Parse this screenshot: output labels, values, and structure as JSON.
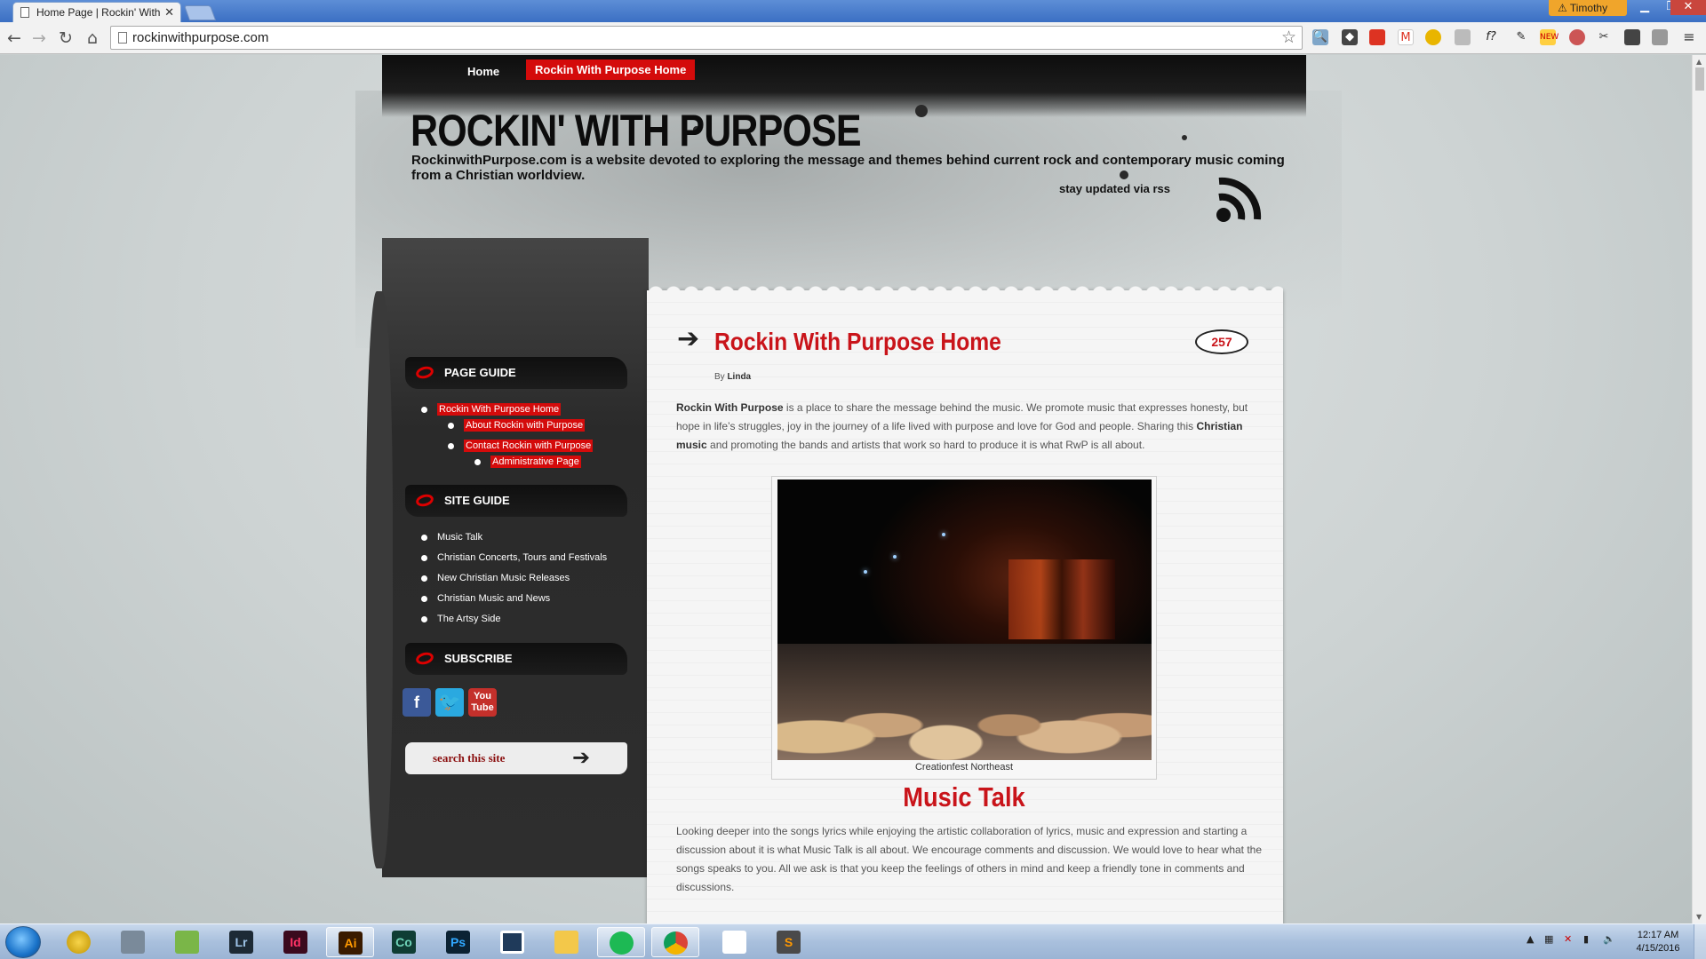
{
  "browser": {
    "tab_title": "Home Page | Rockin' With",
    "tab_close": "✕",
    "user_name": "Timothy",
    "url": "rockinwithpurpose.com"
  },
  "site": {
    "nav": {
      "home": "Home",
      "active": "Rockin With Purpose Home"
    },
    "title": "ROCKIN' WITH PURPOSE",
    "description": "RockinwithPurpose.com is a website devoted to exploring the message and themes behind current rock and contemporary music coming from a Christian worldview.",
    "rss_text": "stay updated via rss"
  },
  "sidebar": {
    "page_guide": {
      "heading": "PAGE GUIDE",
      "items": [
        "Rockin With Purpose Home",
        "About Rockin with Purpose",
        "Contact Rockin with Purpose",
        "Administrative Page"
      ]
    },
    "site_guide": {
      "heading": "SITE GUIDE",
      "items": [
        "Music Talk",
        "Christian Concerts, Tours and Festivals",
        "New Christian Music Releases",
        "Christian Music and News",
        "The Artsy Side"
      ]
    },
    "subscribe": {
      "heading": "SUBSCRIBE",
      "icons": [
        "facebook-icon",
        "twitter-icon",
        "youtube-icon"
      ],
      "youtube_top": "You",
      "youtube_bottom": "Tube"
    },
    "search_placeholder": "search this site"
  },
  "post": {
    "title": "Rockin With Purpose Home",
    "comment_count": "257",
    "by_label": "By",
    "author": "Linda",
    "intro": {
      "bold1": "Rockin With Purpose",
      "text1": " is a place to share the message behind the music. We promote music that expresses honesty, but hope in life’s struggles, joy in the journey of a life lived with purpose and love for God and people.  Sharing this ",
      "bold2": "Christian music",
      "text2": " and promoting the bands and artists that work so hard to produce it is what RwP is all about."
    },
    "photo_caption": "Creationfest Northeast",
    "section_title": "Music Talk",
    "section_text": "Looking deeper into the songs lyrics while enjoying the artistic collaboration of lyrics, music and expression and starting a discussion about it is what Music Talk is all about. We encourage comments and discussion. We would love to hear what the songs speaks to you. All we ask is that you keep the feelings of others in mind and keep a friendly tone in comments and discussions."
  },
  "taskbar": {
    "apps": [
      "Lr",
      "Id",
      "Ai",
      "Co",
      "Ps"
    ],
    "time": "12:17 AM",
    "date": "4/15/2016"
  }
}
